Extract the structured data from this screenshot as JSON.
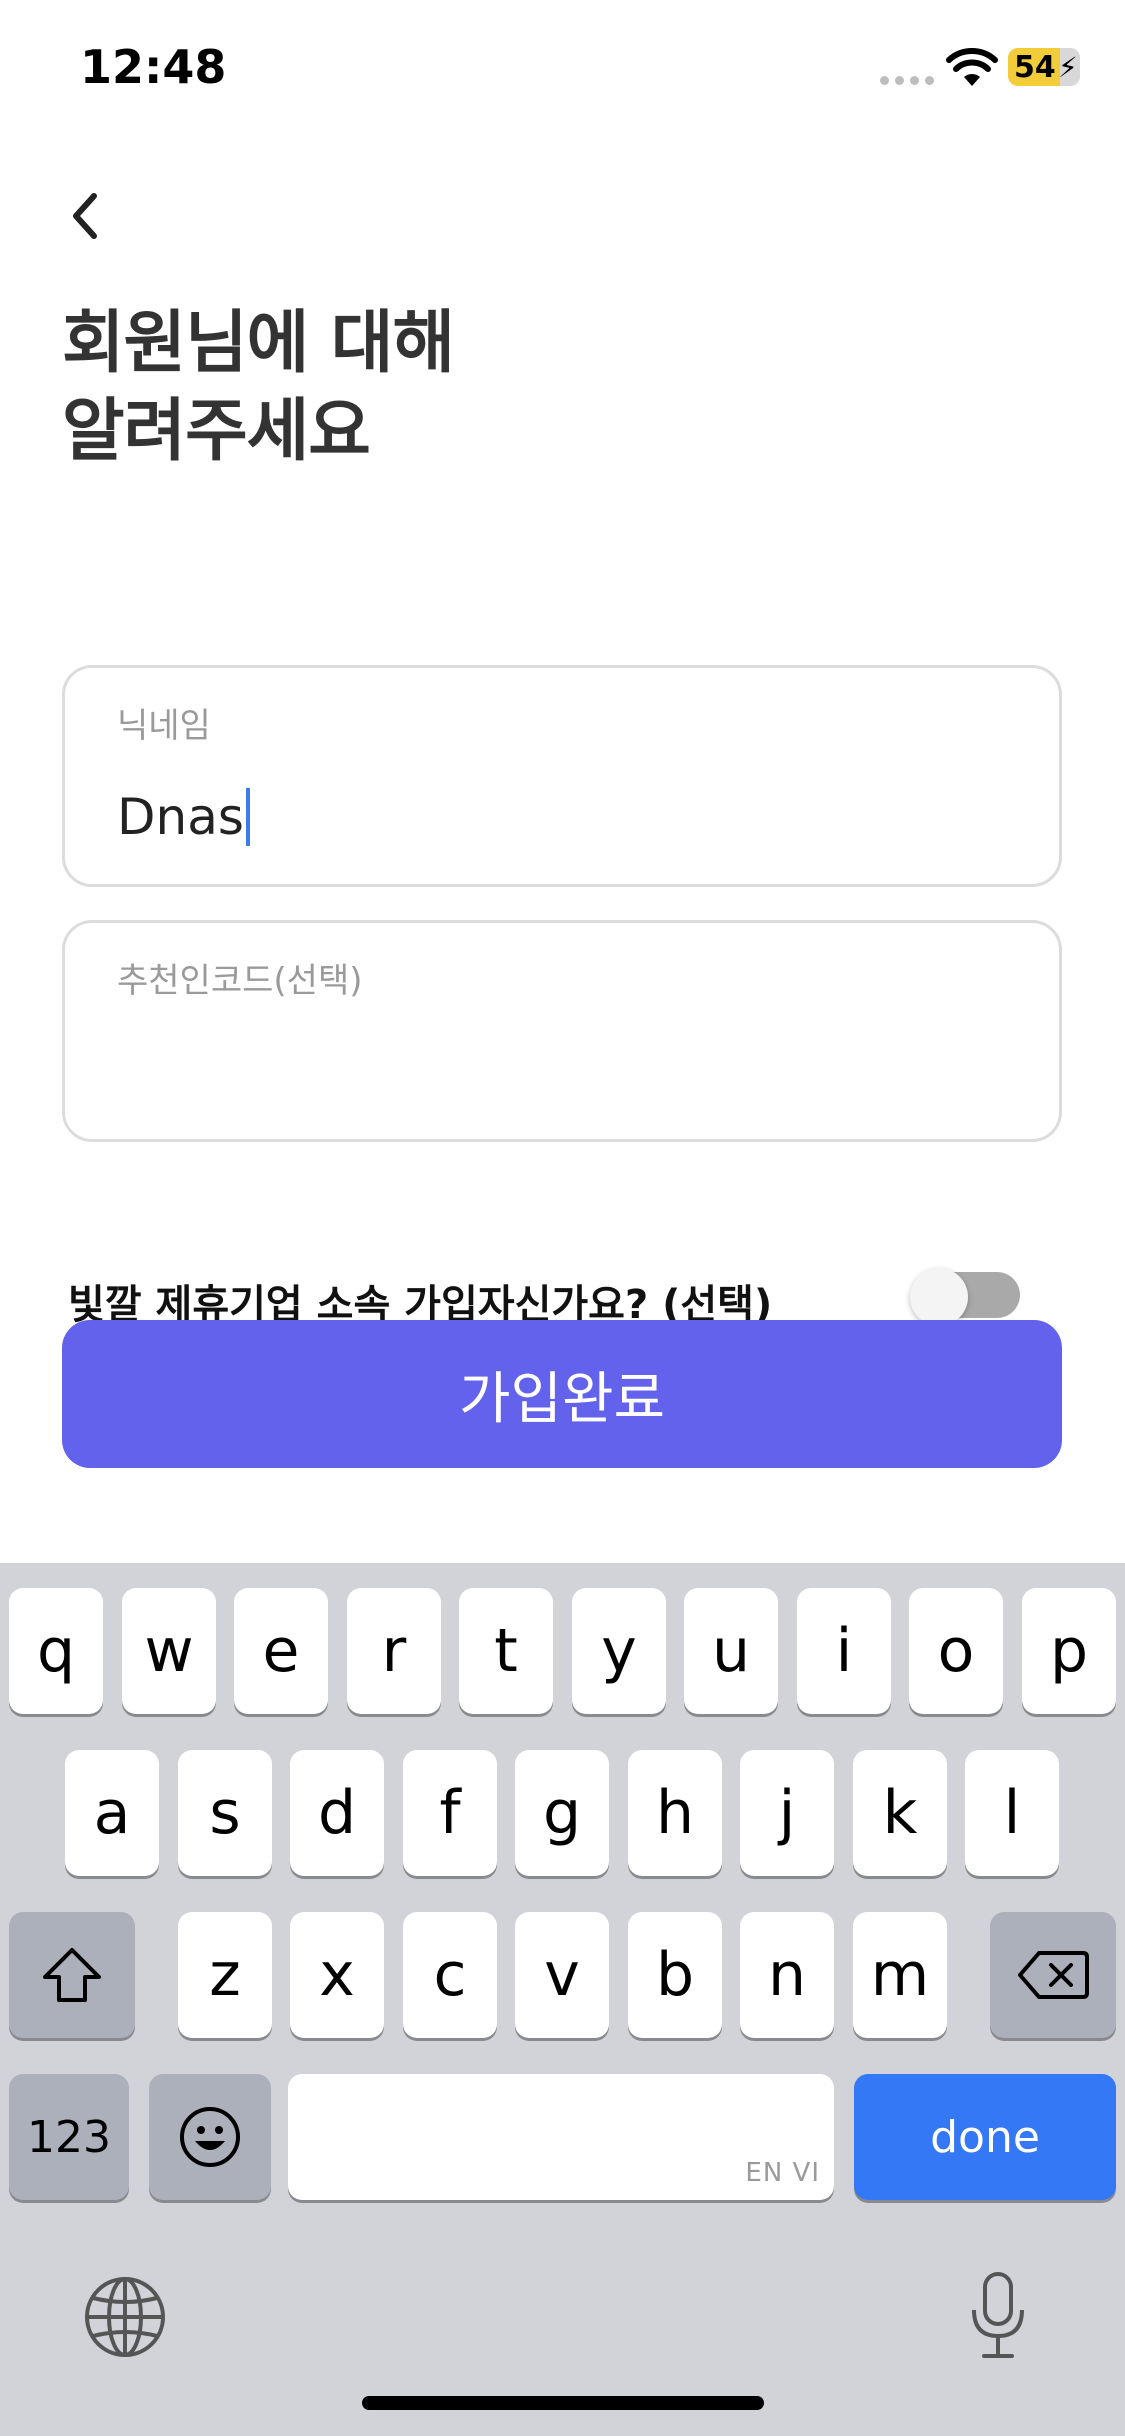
{
  "status_bar": {
    "time": "12:48",
    "battery": "54"
  },
  "header": {
    "title_line1": "회원님에 대해",
    "title_line2": "알려주세요"
  },
  "form": {
    "nickname": {
      "label": "닉네임",
      "value": "Dnas"
    },
    "referral": {
      "label": "추천인코드(선택)",
      "value": ""
    },
    "partner_toggle": {
      "label": "빛깔 제휴기업 소속 가입자신가요? (선택)",
      "checked": false
    },
    "submit_label": "가입완료"
  },
  "keyboard": {
    "row1": [
      "q",
      "w",
      "e",
      "r",
      "t",
      "y",
      "u",
      "i",
      "o",
      "p"
    ],
    "row2": [
      "a",
      "s",
      "d",
      "f",
      "g",
      "h",
      "j",
      "k",
      "l"
    ],
    "row3": [
      "z",
      "x",
      "c",
      "v",
      "b",
      "n",
      "m"
    ],
    "numbers_label": "123",
    "space_lang": "EN VI",
    "done_label": "done"
  },
  "colors": {
    "primary": "#6262ec",
    "keyboard_done": "#3478f6"
  }
}
